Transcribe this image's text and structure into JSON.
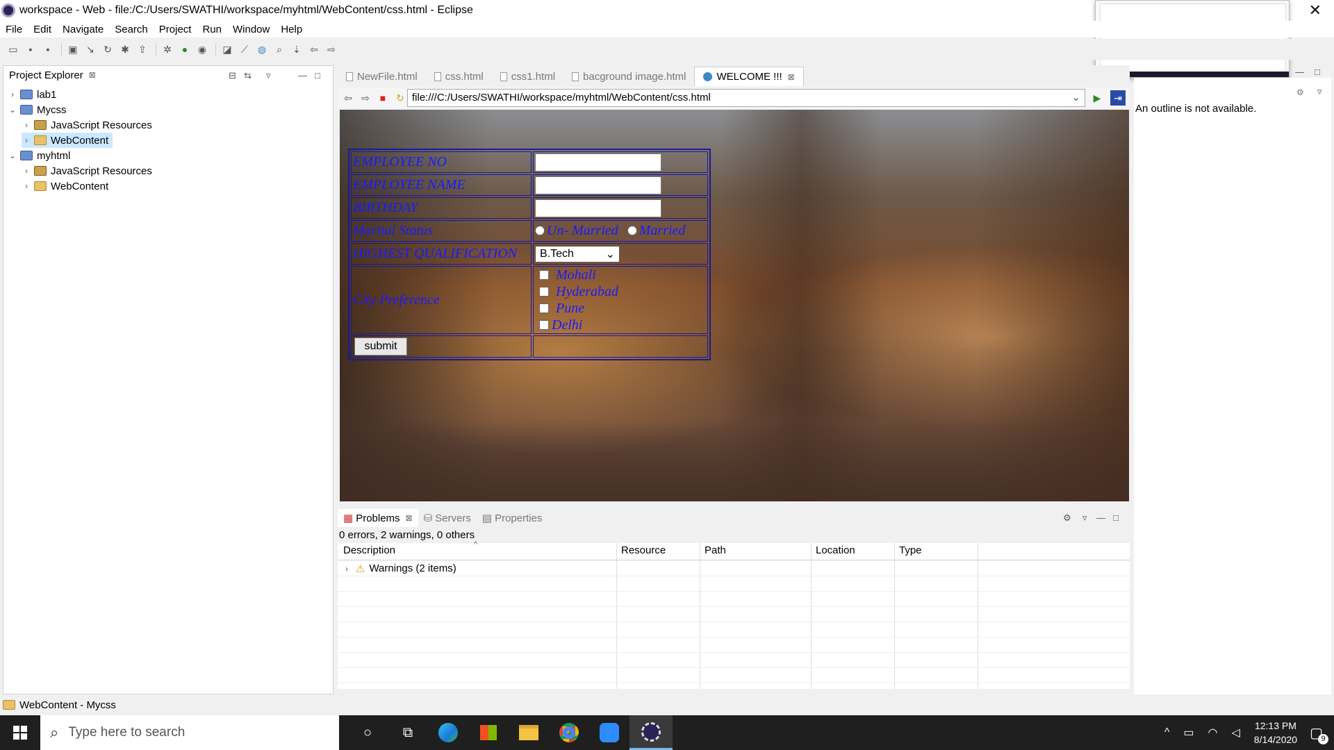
{
  "window": {
    "title": "workspace - Web - file:/C:/Users/SWATHI/workspace/myhtml/WebContent/css.html - Eclipse",
    "close_glyph": "✕"
  },
  "menu": [
    "File",
    "Edit",
    "Navigate",
    "Search",
    "Project",
    "Run",
    "Window",
    "Help"
  ],
  "project_explorer": {
    "title": "Project Explorer",
    "close_glyph": "⊠",
    "items": [
      {
        "label": "lab1",
        "twisty": "›",
        "icon": "project-folder-icon"
      },
      {
        "label": "Mycss",
        "twisty": "⌄",
        "icon": "project-icon"
      },
      {
        "label": "JavaScript Resources",
        "twisty": "›",
        "icon": "js-resources-icon"
      },
      {
        "label": "WebContent",
        "twisty": "›",
        "icon": "folder-icon"
      },
      {
        "label": "myhtml",
        "twisty": "⌄",
        "icon": "project-icon"
      },
      {
        "label": "JavaScript Resources",
        "twisty": "›",
        "icon": "js-resources-icon"
      },
      {
        "label": "WebContent",
        "twisty": "›",
        "icon": "folder-icon"
      }
    ]
  },
  "editor": {
    "tabs": [
      "NewFile.html",
      "css.html",
      "css1.html",
      "bacground image.html",
      "WELCOME !!!"
    ],
    "tab_close_glyph": "⊠",
    "url": "file:///C:/Users/SWATHI/workspace/myhtml/WebContent/css.html",
    "url_dropdown_glyph": "⌄",
    "go_glyph": "▶"
  },
  "form": {
    "employee_no": "EMPLOYEE NO",
    "employee_name": "EMPLOYEE NAME",
    "birthday": "BIRTHDAY",
    "marital_status": "Marital Status",
    "radio_unmarried": "Un- Married",
    "radio_married": "Married",
    "highest_qualification": "HIGHEST QUALIFICATION",
    "qualification_selected": "B.Tech",
    "select_arrow_glyph": "⌄",
    "city_preference": "City Preference",
    "cities": [
      "Mohali",
      "Hyderabad",
      "Pune",
      "Delhi"
    ],
    "submit": "submit"
  },
  "problems": {
    "tabs": [
      "Problems",
      "Servers",
      "Properties"
    ],
    "close_glyph": "⊠",
    "summary": "0 errors, 2 warnings, 0 others",
    "sort_glyph": "^",
    "columns": [
      "Description",
      "Resource",
      "Path",
      "Location",
      "Type"
    ],
    "rows": [
      {
        "description": "Warnings (2 items)",
        "twisty": "›"
      }
    ]
  },
  "outline": {
    "message": "An outline is not available."
  },
  "status": {
    "text": "WebContent - Mycss"
  },
  "taskbar": {
    "search_placeholder": "Type here to search",
    "search_glyph": "⌕",
    "taskview_glyph": "○",
    "time": "12:13 PM",
    "date": "8/14/2020",
    "notification_count": "9",
    "tray_chevron_glyph": "^"
  },
  "colors": {
    "form_text": "#1a1aff",
    "form_border": "#1a1a9a",
    "selected_bg": "#cce8ff",
    "taskbar": "#1f1f1f"
  }
}
